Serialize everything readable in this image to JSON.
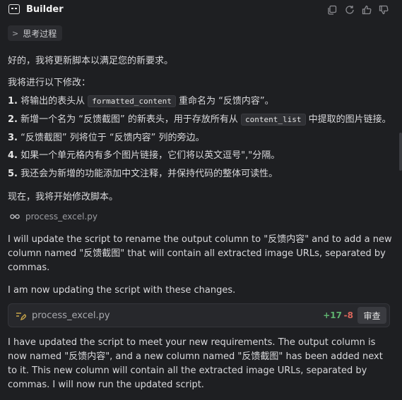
{
  "header": {
    "title": "Builder",
    "icons": [
      "copy-icon",
      "refresh-icon",
      "thumbs-up-icon",
      "thumbs-down-icon"
    ]
  },
  "thinking": {
    "label": "思考过程"
  },
  "intro": "好的，我将更新脚本以满足您的新要求。",
  "list_heading": "我将进行以下修改：",
  "list": [
    {
      "num": "1.",
      "pre": "将输出的表头从",
      "code": "formatted_content",
      "post": "重命名为 “反馈内容”。"
    },
    {
      "num": "2.",
      "pre": "新增一个名为 “反馈截图” 的新表头，用于存放所有从",
      "code": "content_list",
      "post": "中提取的图片链接。"
    },
    {
      "num": "3.",
      "pre": "“反馈截图” 列将位于 “反馈内容” 列的旁边。",
      "code": "",
      "post": ""
    },
    {
      "num": "4.",
      "pre": "如果一个单元格内有多个图片链接，它们将以英文逗号\",\"分隔。",
      "code": "",
      "post": ""
    },
    {
      "num": "5.",
      "pre": "我还会为新增的功能添加中文注释，并保持代码的整体可读性。",
      "code": "",
      "post": ""
    }
  ],
  "start_text": "现在，我将开始修改脚本。",
  "file_ref": {
    "name": "process_excel.py",
    "icon": "glasses-icon"
  },
  "en_para1": "I will update the script to rename the output column to \"反馈内容\" and to add a new column named \"反馈截图\" that will contain all extracted image URLs, separated by commas.",
  "en_para2": "I am now updating the script with these changes.",
  "file_bar": {
    "name": "process_excel.py",
    "additions": "+17",
    "deletions": "-8",
    "review_label": "审查",
    "icon": "edit-file-icon"
  },
  "en_para3": "I have updated the script to meet your new requirements. The output column is now named \"反馈内容\", and a new column named \"反馈截图\" has been added next to it. This new column will contain all the extracted image URLs, separated by commas. I will now run the updated script.",
  "colors": {
    "background": "#1e1f22",
    "additions": "#5fb36f",
    "deletions": "#d9665b"
  }
}
